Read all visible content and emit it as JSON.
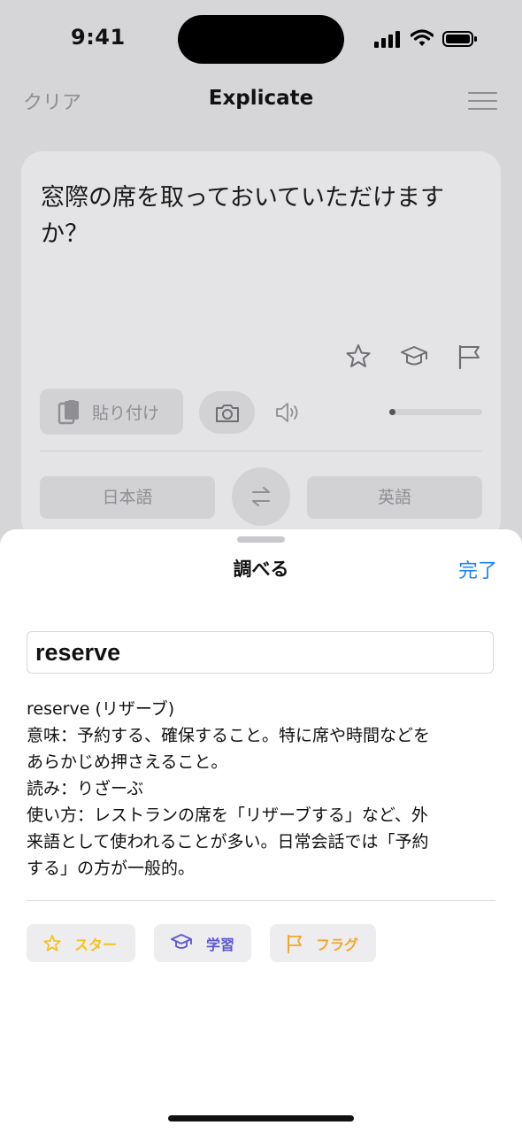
{
  "status_bar": {
    "time": "9:41"
  },
  "nav": {
    "clear_label": "クリア",
    "title": "Explicate"
  },
  "card": {
    "source_text": "窓際の席を取っておいていただけますか？",
    "paste_label": "貼り付け",
    "source_language": "日本語",
    "target_language": "英語",
    "audio_progress": 0.0
  },
  "sheet": {
    "title": "調べる",
    "done_label": "完了",
    "search_value": "reserve",
    "definition_lines": [
      "reserve (リザーブ)",
      "意味：予約する、確保すること。特に席や時間などを",
      "あらかじめ押さえること。",
      "読み：りざーぶ",
      "使い方：レストランの席を「リザーブする」など、外",
      "来語として使われることが多い。日常会話では「予約",
      "する」の方が一般的。"
    ],
    "actions": {
      "star_label": "スター",
      "learn_label": "学習",
      "flag_label": "フラグ"
    }
  },
  "colors": {
    "accent_blue": "#1a82ff",
    "star_yellow": "#f5c21b",
    "learn_purple": "#5b57d6",
    "flag_orange": "#f5a623"
  }
}
